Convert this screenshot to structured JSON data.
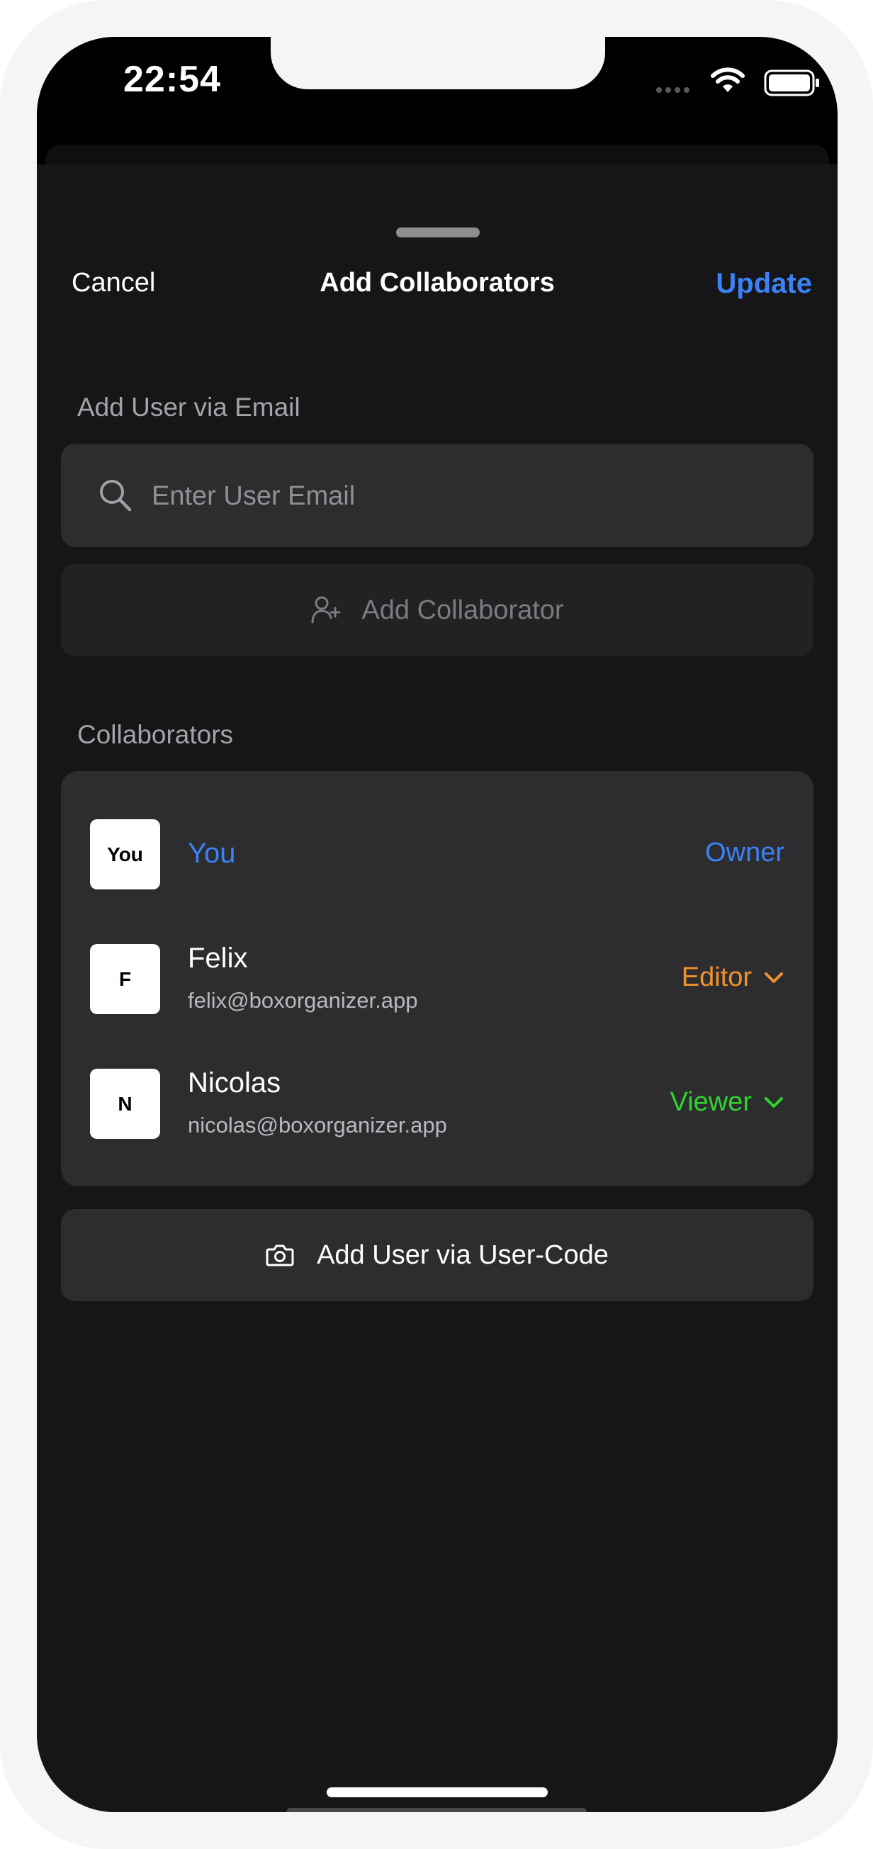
{
  "status_bar": {
    "time": "22:54",
    "icons": [
      "signal-icon",
      "wifi-icon",
      "battery-icon"
    ]
  },
  "nav": {
    "cancel_label": "Cancel",
    "title": "Add Collaborators",
    "update_label": "Update"
  },
  "add_by_email": {
    "section_label": "Add User via Email",
    "placeholder": "Enter User Email",
    "value": "",
    "add_button_label": "Add Collaborator"
  },
  "collaborators": {
    "section_label": "Collaborators",
    "items": [
      {
        "avatar": "You",
        "name": "You",
        "email": "",
        "role": "Owner",
        "role_color": "#3a82f7",
        "has_dropdown": false
      },
      {
        "avatar": "F",
        "name": "Felix",
        "email": "felix@boxorganizer.app",
        "role": "Editor",
        "role_color": "#f0922d",
        "has_dropdown": true
      },
      {
        "avatar": "N",
        "name": "Nicolas",
        "email": "nicolas@boxorganizer.app",
        "role": "Viewer",
        "role_color": "#2fd32f",
        "has_dropdown": true
      }
    ]
  },
  "user_code_button_label": "Add User via User-Code",
  "colors": {
    "accent": "#3a82f7",
    "sheet_background": "#161518",
    "card_background": "#2d2c2f"
  }
}
